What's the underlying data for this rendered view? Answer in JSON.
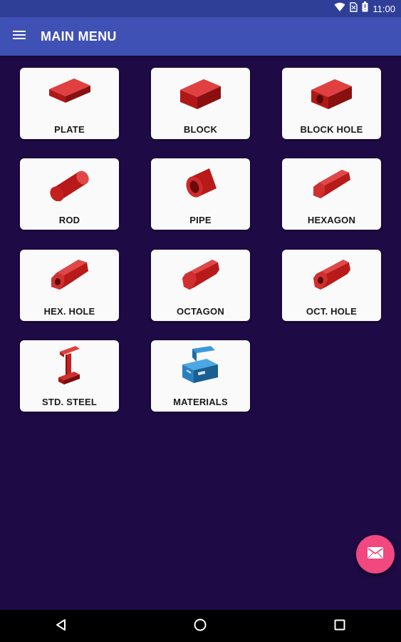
{
  "status_bar": {
    "time": "11:00"
  },
  "app_bar": {
    "title": "MAIN MENU"
  },
  "menu": {
    "items": [
      {
        "label": "PLATE"
      },
      {
        "label": "BLOCK"
      },
      {
        "label": "BLOCK HOLE"
      },
      {
        "label": "ROD"
      },
      {
        "label": "PIPE"
      },
      {
        "label": "HEXAGON"
      },
      {
        "label": "HEX. HOLE"
      },
      {
        "label": "OCTAGON"
      },
      {
        "label": "OCT. HOLE"
      },
      {
        "label": "STD. STEEL"
      },
      {
        "label": "MATERIALS"
      }
    ]
  },
  "icons": {
    "menu": "hamburger-icon",
    "fab": "mail-icon",
    "nav_back": "back-triangle-icon",
    "nav_home": "home-circle-icon",
    "nav_recents": "recents-square-icon"
  },
  "colors": {
    "background": "#1e0a45",
    "app_bar": "#3f51b5",
    "status_bar": "#2f3f98",
    "shape_red": "#c41a1a",
    "fab": "#f0487f"
  }
}
